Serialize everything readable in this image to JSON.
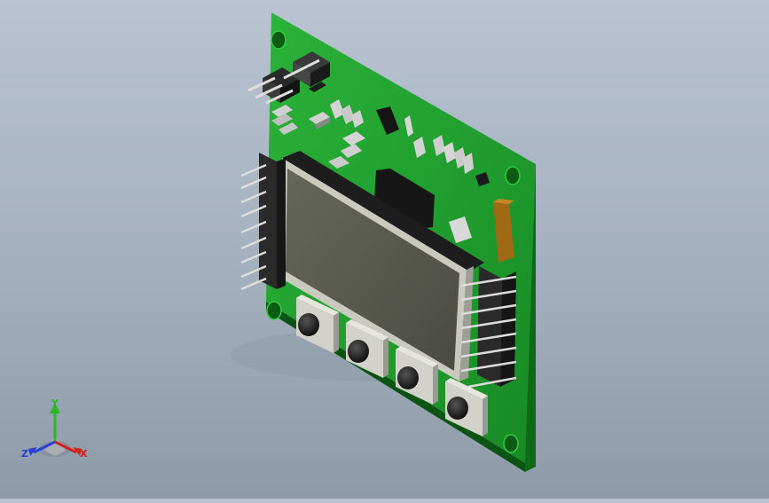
{
  "scene": {
    "description_visible": false,
    "colors": {
      "background_top": "#b9c3d1",
      "background_bottom": "#8f9aa8",
      "pcb": "#1e9a2c",
      "pcb_edge": "#0f5a17",
      "lcd_frame": "#c9c9c0",
      "lcd_screen": "#56574d",
      "button_base": "#cfcfc8",
      "button_cap": "#1a1a1a",
      "header_black": "#2a2a2a",
      "pin_silver": "#d8d8d8",
      "tantalum": "#a06a14"
    }
  },
  "triad": {
    "x_label": "X",
    "y_label": "Y",
    "z_label": "Z",
    "x_color": "#d61f1f",
    "y_color": "#2bb52b",
    "z_color": "#2a3fd6"
  }
}
